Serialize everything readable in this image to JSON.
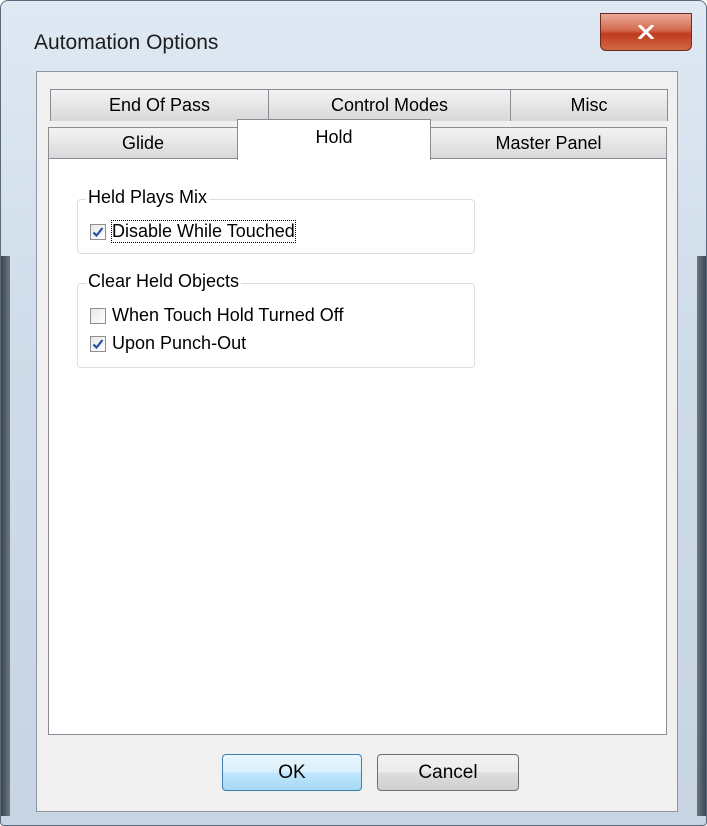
{
  "window": {
    "title": "Automation Options",
    "close_label": "x"
  },
  "tabs": {
    "row1": [
      "End Of Pass",
      "Control Modes",
      "Misc"
    ],
    "row2": [
      "Glide",
      "Hold",
      "Master Panel"
    ],
    "active": "Hold"
  },
  "groups": {
    "held_plays_mix": {
      "title": "Held Plays Mix",
      "items": [
        {
          "label": "Disable While Touched",
          "checked": true
        }
      ]
    },
    "clear_held_objects": {
      "title": "Clear Held Objects",
      "items": [
        {
          "label": "When Touch Hold Turned Off",
          "checked": false
        },
        {
          "label": "Upon Punch-Out",
          "checked": true
        }
      ]
    }
  },
  "buttons": {
    "ok": "OK",
    "cancel": "Cancel"
  },
  "colors": {
    "checkmark": "#2a4fa8",
    "close_button": "#c84a2c"
  }
}
